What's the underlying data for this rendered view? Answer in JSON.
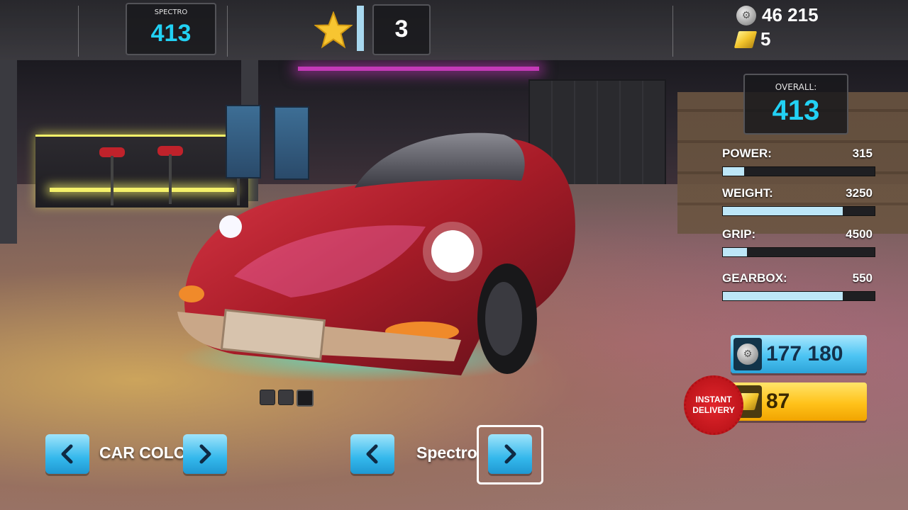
{
  "topbar": {
    "car_label": "SPECTRO",
    "car_rating": "413",
    "stars": "3",
    "coins": "46 215",
    "gold": "5"
  },
  "stats": {
    "overall_label": "OVERALL:",
    "overall_value": "413",
    "items": [
      {
        "name": "POWER:",
        "value": "315",
        "fill": 0.14
      },
      {
        "name": "WEIGHT:",
        "value": "3250",
        "fill": 0.79
      },
      {
        "name": "GRIP:",
        "value": "4500",
        "fill": 0.16
      },
      {
        "name": "GEARBOX:",
        "value": "550",
        "fill": 0.79
      }
    ]
  },
  "purchase": {
    "coin_price": "177 180",
    "gold_price": "87",
    "badge_line1": "INSTANT",
    "badge_line2": "DELIVERY"
  },
  "nav": {
    "color_label": "CAR COLOR",
    "car_name": "Spectro"
  },
  "colors": {
    "accent_cyan": "#22d1f4",
    "button_blue": "#34b8ec",
    "button_gold": "#ffc21a",
    "car_red": "#b8202a"
  },
  "icons": {
    "star": "star-icon",
    "coin": "silver-coin-icon",
    "gold": "gold-bar-icon",
    "left": "chevron-left-icon",
    "right": "chevron-right-icon"
  },
  "gallery": {
    "count": 3,
    "active_index": 2
  }
}
